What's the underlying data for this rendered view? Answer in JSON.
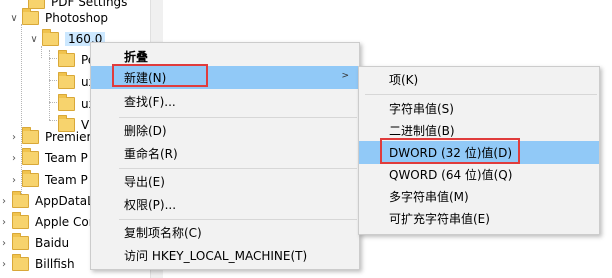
{
  "tree": {
    "items": [
      {
        "label": "PDF Settings"
      },
      {
        "label": "Photoshop"
      },
      {
        "label": "160.0"
      },
      {
        "label": "Pe"
      },
      {
        "label": "ux"
      },
      {
        "label": "ux"
      },
      {
        "label": "Vi"
      },
      {
        "label": "Premier"
      },
      {
        "label": "Team P"
      },
      {
        "label": "Team P"
      },
      {
        "label": "AppDataLo"
      },
      {
        "label": "Apple Cor"
      },
      {
        "label": "Baidu"
      },
      {
        "label": "Billfish"
      }
    ]
  },
  "context_menu": {
    "items": [
      {
        "label": "折叠"
      },
      {
        "label": "新建(N)"
      },
      {
        "label": "查找(F)..."
      },
      {
        "label": "删除(D)"
      },
      {
        "label": "重命名(R)"
      },
      {
        "label": "导出(E)"
      },
      {
        "label": "权限(P)..."
      },
      {
        "label": "复制项名称(C)"
      },
      {
        "label": "访问 HKEY_LOCAL_MACHINE(T)"
      }
    ]
  },
  "submenu": {
    "items": [
      {
        "label": "项(K)"
      },
      {
        "label": "字符串值(S)"
      },
      {
        "label": "二进制值(B)"
      },
      {
        "label": "DWORD (32 位)值(D)"
      },
      {
        "label": "QWORD (64 位)值(Q)"
      },
      {
        "label": "多字符串值(M)"
      },
      {
        "label": "可扩充字符串值(E)"
      }
    ]
  },
  "colors": {
    "highlight": "#91c9f7",
    "annotation_red": "#e03c3c",
    "folder_yellow": "#f7d36d"
  },
  "icons": {
    "expanded": "chevron-down-icon",
    "collapsed": "chevron-right-icon",
    "folder": "folder-icon",
    "submenu_arrow": "chevron-right-icon"
  }
}
